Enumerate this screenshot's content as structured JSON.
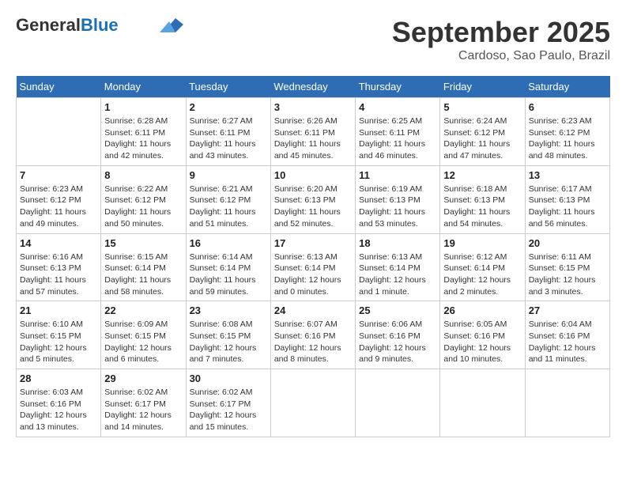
{
  "logo": {
    "general": "General",
    "blue": "Blue"
  },
  "title": "September 2025",
  "subtitle": "Cardoso, Sao Paulo, Brazil",
  "weekdays": [
    "Sunday",
    "Monday",
    "Tuesday",
    "Wednesday",
    "Thursday",
    "Friday",
    "Saturday"
  ],
  "weeks": [
    [
      {
        "day": "",
        "info": ""
      },
      {
        "day": "1",
        "info": "Sunrise: 6:28 AM\nSunset: 6:11 PM\nDaylight: 11 hours\nand 42 minutes."
      },
      {
        "day": "2",
        "info": "Sunrise: 6:27 AM\nSunset: 6:11 PM\nDaylight: 11 hours\nand 43 minutes."
      },
      {
        "day": "3",
        "info": "Sunrise: 6:26 AM\nSunset: 6:11 PM\nDaylight: 11 hours\nand 45 minutes."
      },
      {
        "day": "4",
        "info": "Sunrise: 6:25 AM\nSunset: 6:11 PM\nDaylight: 11 hours\nand 46 minutes."
      },
      {
        "day": "5",
        "info": "Sunrise: 6:24 AM\nSunset: 6:12 PM\nDaylight: 11 hours\nand 47 minutes."
      },
      {
        "day": "6",
        "info": "Sunrise: 6:23 AM\nSunset: 6:12 PM\nDaylight: 11 hours\nand 48 minutes."
      }
    ],
    [
      {
        "day": "7",
        "info": "Sunrise: 6:23 AM\nSunset: 6:12 PM\nDaylight: 11 hours\nand 49 minutes."
      },
      {
        "day": "8",
        "info": "Sunrise: 6:22 AM\nSunset: 6:12 PM\nDaylight: 11 hours\nand 50 minutes."
      },
      {
        "day": "9",
        "info": "Sunrise: 6:21 AM\nSunset: 6:12 PM\nDaylight: 11 hours\nand 51 minutes."
      },
      {
        "day": "10",
        "info": "Sunrise: 6:20 AM\nSunset: 6:13 PM\nDaylight: 11 hours\nand 52 minutes."
      },
      {
        "day": "11",
        "info": "Sunrise: 6:19 AM\nSunset: 6:13 PM\nDaylight: 11 hours\nand 53 minutes."
      },
      {
        "day": "12",
        "info": "Sunrise: 6:18 AM\nSunset: 6:13 PM\nDaylight: 11 hours\nand 54 minutes."
      },
      {
        "day": "13",
        "info": "Sunrise: 6:17 AM\nSunset: 6:13 PM\nDaylight: 11 hours\nand 56 minutes."
      }
    ],
    [
      {
        "day": "14",
        "info": "Sunrise: 6:16 AM\nSunset: 6:13 PM\nDaylight: 11 hours\nand 57 minutes."
      },
      {
        "day": "15",
        "info": "Sunrise: 6:15 AM\nSunset: 6:14 PM\nDaylight: 11 hours\nand 58 minutes."
      },
      {
        "day": "16",
        "info": "Sunrise: 6:14 AM\nSunset: 6:14 PM\nDaylight: 11 hours\nand 59 minutes."
      },
      {
        "day": "17",
        "info": "Sunrise: 6:13 AM\nSunset: 6:14 PM\nDaylight: 12 hours\nand 0 minutes."
      },
      {
        "day": "18",
        "info": "Sunrise: 6:13 AM\nSunset: 6:14 PM\nDaylight: 12 hours\nand 1 minute."
      },
      {
        "day": "19",
        "info": "Sunrise: 6:12 AM\nSunset: 6:14 PM\nDaylight: 12 hours\nand 2 minutes."
      },
      {
        "day": "20",
        "info": "Sunrise: 6:11 AM\nSunset: 6:15 PM\nDaylight: 12 hours\nand 3 minutes."
      }
    ],
    [
      {
        "day": "21",
        "info": "Sunrise: 6:10 AM\nSunset: 6:15 PM\nDaylight: 12 hours\nand 5 minutes."
      },
      {
        "day": "22",
        "info": "Sunrise: 6:09 AM\nSunset: 6:15 PM\nDaylight: 12 hours\nand 6 minutes."
      },
      {
        "day": "23",
        "info": "Sunrise: 6:08 AM\nSunset: 6:15 PM\nDaylight: 12 hours\nand 7 minutes."
      },
      {
        "day": "24",
        "info": "Sunrise: 6:07 AM\nSunset: 6:16 PM\nDaylight: 12 hours\nand 8 minutes."
      },
      {
        "day": "25",
        "info": "Sunrise: 6:06 AM\nSunset: 6:16 PM\nDaylight: 12 hours\nand 9 minutes."
      },
      {
        "day": "26",
        "info": "Sunrise: 6:05 AM\nSunset: 6:16 PM\nDaylight: 12 hours\nand 10 minutes."
      },
      {
        "day": "27",
        "info": "Sunrise: 6:04 AM\nSunset: 6:16 PM\nDaylight: 12 hours\nand 11 minutes."
      }
    ],
    [
      {
        "day": "28",
        "info": "Sunrise: 6:03 AM\nSunset: 6:16 PM\nDaylight: 12 hours\nand 13 minutes."
      },
      {
        "day": "29",
        "info": "Sunrise: 6:02 AM\nSunset: 6:17 PM\nDaylight: 12 hours\nand 14 minutes."
      },
      {
        "day": "30",
        "info": "Sunrise: 6:02 AM\nSunset: 6:17 PM\nDaylight: 12 hours\nand 15 minutes."
      },
      {
        "day": "",
        "info": ""
      },
      {
        "day": "",
        "info": ""
      },
      {
        "day": "",
        "info": ""
      },
      {
        "day": "",
        "info": ""
      }
    ]
  ]
}
